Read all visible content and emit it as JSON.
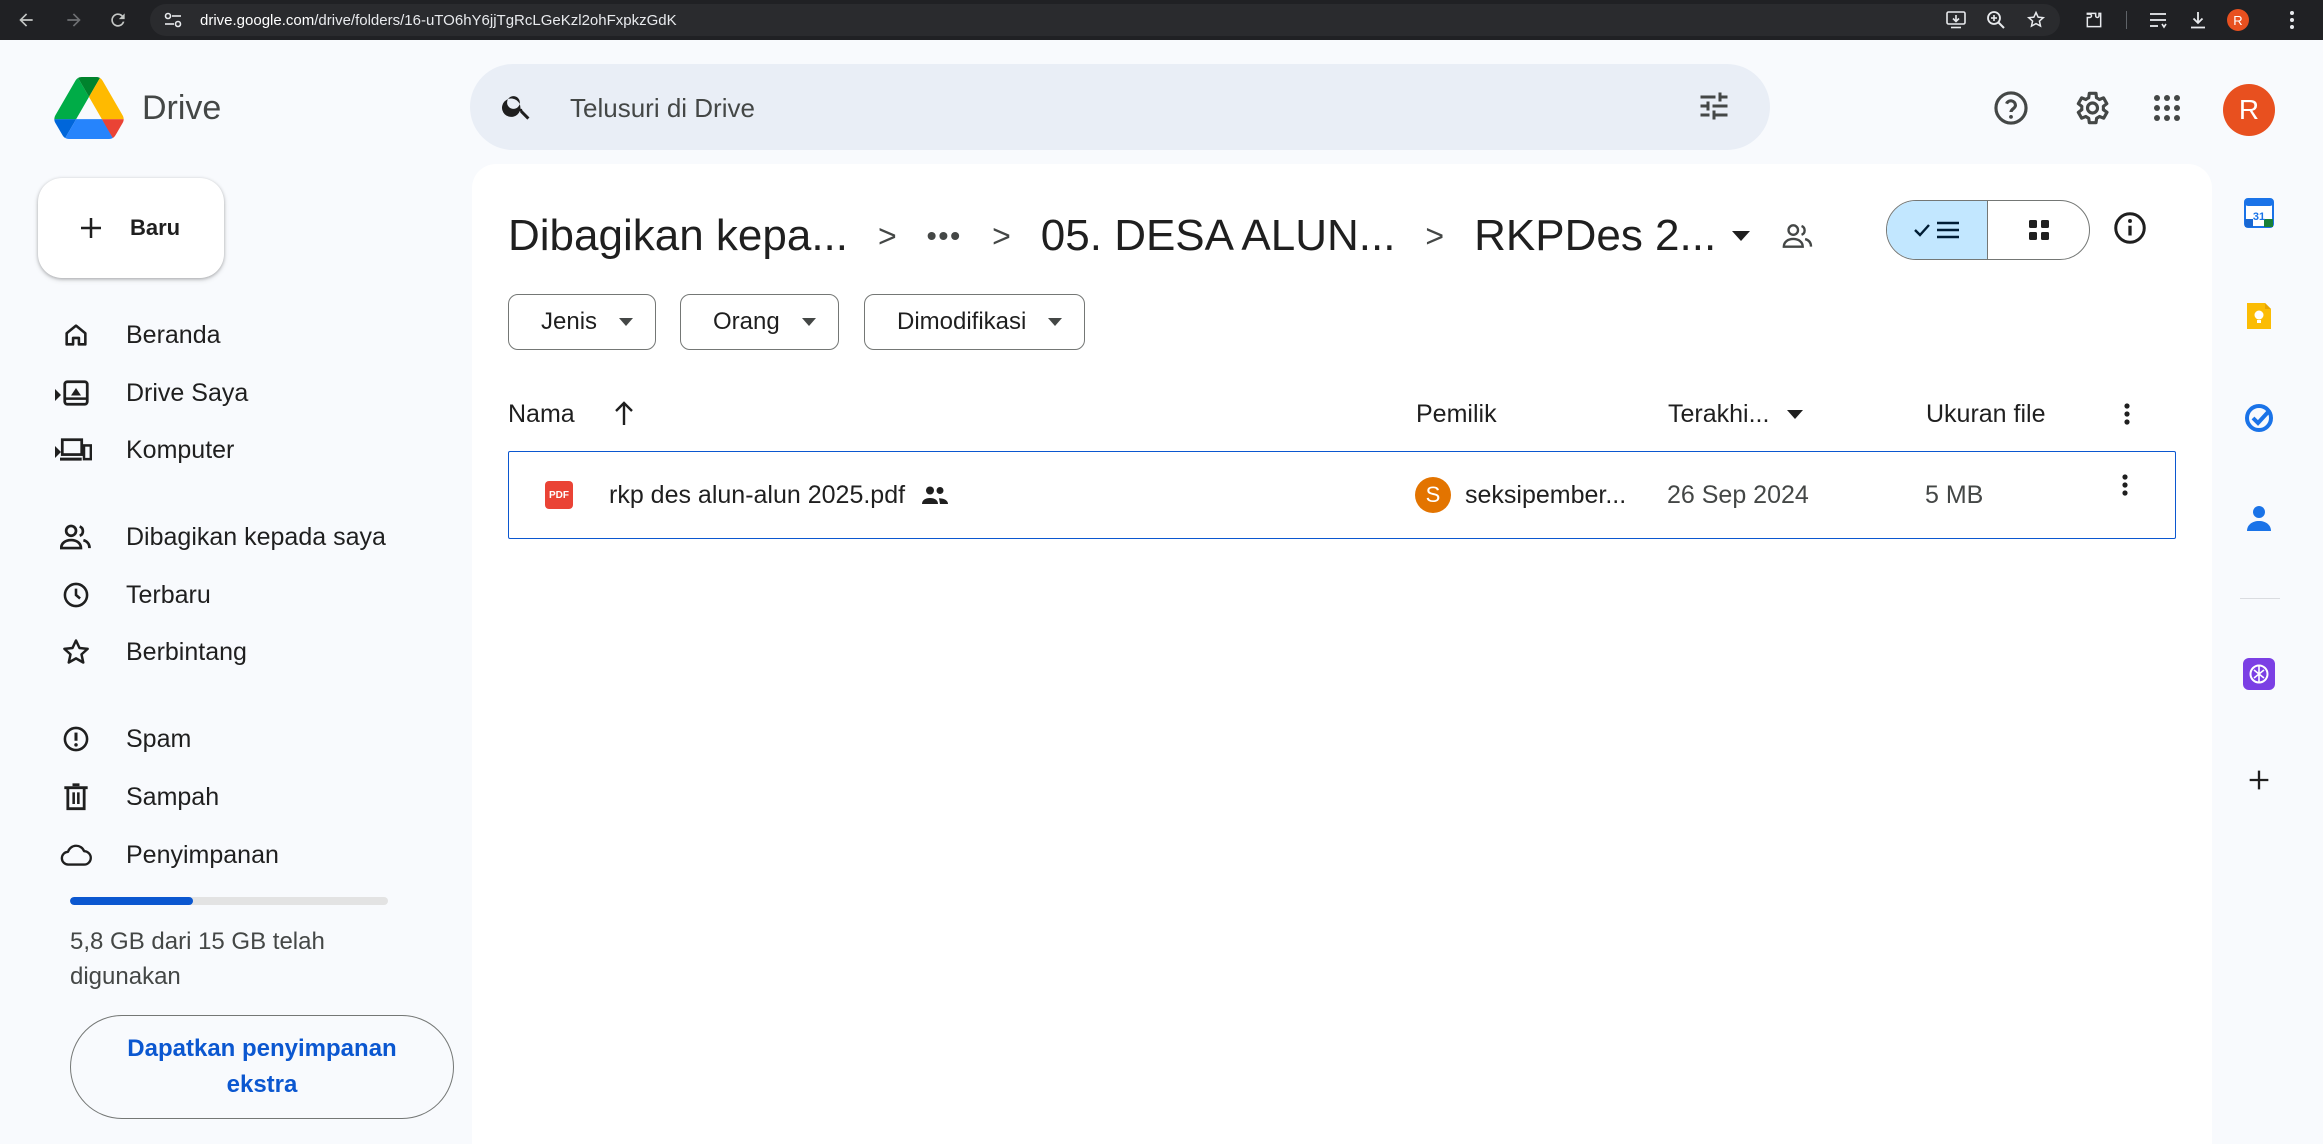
{
  "browser": {
    "url_host": "drive.google.com",
    "url_path": "/drive/folders/16-uTO6hY6jjTgRcLGeKzl2ohFxpkzGdK",
    "profile_initial": "R"
  },
  "app": {
    "name": "Drive",
    "search_placeholder": "Telusuri di Drive",
    "user_initial": "R"
  },
  "sidebar": {
    "new_label": "Baru",
    "items": [
      {
        "label": "Beranda",
        "icon": "home-icon"
      },
      {
        "label": "Drive Saya",
        "icon": "my-drive-icon"
      },
      {
        "label": "Komputer",
        "icon": "computer-icon"
      },
      {
        "label": "Dibagikan kepada saya",
        "icon": "shared-icon"
      },
      {
        "label": "Terbaru",
        "icon": "clock-icon"
      },
      {
        "label": "Berbintang",
        "icon": "star-icon"
      },
      {
        "label": "Spam",
        "icon": "spam-icon"
      },
      {
        "label": "Sampah",
        "icon": "trash-icon"
      },
      {
        "label": "Penyimpanan",
        "icon": "cloud-icon"
      }
    ],
    "storage": {
      "used_fraction": 0.387,
      "text": "5,8 GB dari 15 GB telah digunakan",
      "button_label": "Dapatkan penyimpanan ekstra"
    }
  },
  "breadcrumb": {
    "items": [
      "Dibagikan kepa...",
      "•••",
      "05. DESA ALUN...",
      "RKPDes 2..."
    ],
    "separator": ">"
  },
  "filters": [
    "Jenis",
    "Orang",
    "Dimodifikasi"
  ],
  "table": {
    "columns": {
      "name": "Nama",
      "owner": "Pemilik",
      "modified": "Terakhi...",
      "size": "Ukuran file"
    },
    "rows": [
      {
        "file_type_label": "PDF",
        "name": "rkp des alun-alun 2025.pdf",
        "owner_initial": "S",
        "owner": "seksipember...",
        "modified": "26 Sep 2024",
        "size": "5 MB"
      }
    ]
  },
  "side_panel": {
    "calendar_day": "31"
  },
  "colors": {
    "accent": "#0b57d0",
    "selected_toggle": "#c2e7ff",
    "avatar": "#e8501f",
    "owner_avatar": "#e37400",
    "pdf_red": "#ea4335"
  }
}
